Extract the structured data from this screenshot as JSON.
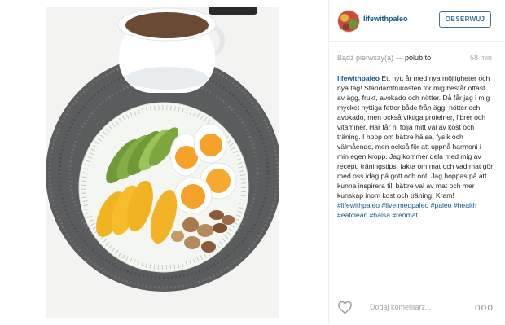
{
  "post": {
    "username": "lifewithpaleo",
    "follow_label": "OBSERWUJ",
    "first_prefix": "Bądź pierwszy(a) —",
    "like_label": "polub to",
    "time_ago": "58 min",
    "caption_user": "lifewithpaleo",
    "caption_text": " Ett nytt år med nya möjligheter och nya tag! Standardfrukosten för mig består oftast av ägg, frukt, avokado och nötter. Då får jag i mig mycket nyttiga fetter både från ägg, nötter och avokado, men också viktiga proteiner, fibrer och vitaminer. Här får ni följa mitt val av kost och träning. I hopp om bättre hälsa, fysik och välmående, men också för att uppnå harmoni i min egen kropp. Jag kommer dela med mig av recept, träningstips, fakta om mat och vad mat gör med oss idag på gott och ont. Jag hoppas på att kunna inspirera till bättre val av mat och mer kunskap inom kost och träning. Kram! ",
    "hashtags": "#lifewithpaleo #livetmedpaleo #paleo #health #eatclean #hälsa #renmat",
    "comment_placeholder": "Dodaj komentarz...",
    "more_label": "ooo"
  },
  "colors": {
    "link": "#125688",
    "follow": "#3f729b",
    "muted": "#a5a7aa"
  },
  "icons": {
    "like": "heart-icon",
    "more": "more-options-icon"
  }
}
